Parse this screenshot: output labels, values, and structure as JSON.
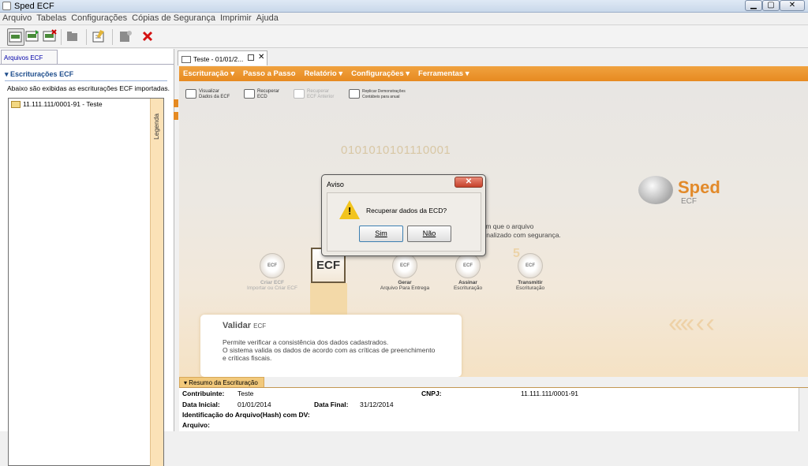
{
  "window": {
    "title": "Sped ECF",
    "min_label": "▁",
    "max_label": "▢",
    "close_label": "✕"
  },
  "menu": {
    "items": [
      "Arquivo",
      "Tabelas",
      "Configurações",
      "Cópias de Segurança",
      "Imprimir",
      "Ajuda"
    ]
  },
  "toolbar": {
    "buttons": [
      {
        "name": "new-ecf-button",
        "icon": "ecf-new-icon"
      },
      {
        "name": "import-ecf-button",
        "icon": "ecf-import-icon"
      },
      {
        "name": "delete-ecf-button",
        "icon": "ecf-delete-icon"
      },
      {
        "name": "open-button",
        "icon": "folder-icon"
      },
      {
        "name": "edit-button",
        "icon": "edit-icon"
      },
      {
        "name": "properties-button",
        "icon": "properties-icon"
      },
      {
        "name": "close-file-button",
        "icon": "red-x-icon"
      }
    ]
  },
  "left_panel": {
    "tab_label": "Arquivos ECF",
    "section_title": "Escriturações ECF",
    "description": "Abaixo são exibidas as escriturações ECF importadas.",
    "tree_item": "11.111.111/0001-91 - Teste",
    "legenda": "Legenda"
  },
  "main_tab": {
    "label": "Teste - 01/01/2..."
  },
  "orange_menu": {
    "items": [
      "Escrituração ▾",
      "Passo a Passo",
      "Relatório ▾",
      "Configurações ▾",
      "Ferramentas ▾"
    ]
  },
  "quick_actions": [
    {
      "line1": "Visualizar",
      "line2": "Dados da ECF"
    },
    {
      "line1": "Recuperar",
      "line2": "ECD"
    },
    {
      "line1": "Recuperar",
      "line2": "ECF Anterior"
    },
    {
      "line1": "Replicar Demonstrações",
      "line2": "Contábeis para anual"
    }
  ],
  "background": {
    "binary": "0101010101110001",
    "logo_main": "Sped",
    "logo_sub": "ECF",
    "text1": "etapa em que o arquivo",
    "text2": "o seja finalizado com segurança."
  },
  "steps": [
    {
      "label": "Criar ECF",
      "sub": "Importar ou Criar ECF",
      "icon_text": "ECF",
      "active": false
    },
    {
      "label": "Gerar",
      "sub": "Arquivo Para Entrega",
      "icon_text": "ECF",
      "active": true
    },
    {
      "label": "Assinar",
      "sub": "Escrituração",
      "icon_text": "ECF",
      "active": true
    },
    {
      "label": "Transmitir",
      "sub": "Escrituração",
      "icon_text": "ECF",
      "active": true
    }
  ],
  "current_step": {
    "icon_text": "ECF",
    "number": "5"
  },
  "validar": {
    "title": "Validar",
    "title_suffix": "ECF",
    "line1": "Permite verificar a consistência dos dados cadastrados.",
    "line2": "O sistema valida os dados de acordo com as críticas de preenchimento",
    "line3": "e críticas fiscais."
  },
  "dialog": {
    "title": "Aviso",
    "message": "Recuperar dados da ECD?",
    "yes_label": "Sim",
    "no_label": "Não",
    "close_label": "✕"
  },
  "resumo": {
    "tab_label": "▾ Resumo da Escrituração",
    "contribuinte_label": "Contribuinte:",
    "contribuinte_value": "Teste",
    "cnpj_label": "CNPJ:",
    "cnpj_value": "11.111.111/0001-91",
    "data_inicial_label": "Data Inicial:",
    "data_inicial_value": "01/01/2014",
    "data_final_label": "Data Final:",
    "data_final_value": "31/12/2014",
    "hash_label": "Identificação do Arquivo(Hash) com DV:",
    "arquivo_label": "Arquivo:"
  },
  "colors": {
    "accent": "#e78a21",
    "panel": "#fbe2b7",
    "close": "#c6412a"
  }
}
